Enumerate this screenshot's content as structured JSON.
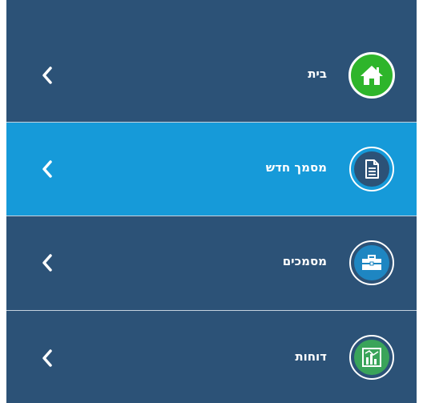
{
  "menu": {
    "items": [
      {
        "label": "בית",
        "icon": "home-icon",
        "state": "default"
      },
      {
        "label": "מסמך חדש",
        "icon": "document-icon",
        "state": "active"
      },
      {
        "label": "מסמכים",
        "icon": "briefcase-icon",
        "state": "default"
      },
      {
        "label": "דוחות",
        "icon": "bar-chart-icon",
        "state": "default"
      }
    ]
  },
  "colors": {
    "menu_background": "#2c5277",
    "active_background": "#169ad9",
    "home_icon_green": "#2eb52b",
    "document_icon_fill": "#2c5277",
    "briefcase_icon_fill": "#1e86c2",
    "report_icon_fill": "#3aa45a",
    "divider": "#c5d2de"
  }
}
